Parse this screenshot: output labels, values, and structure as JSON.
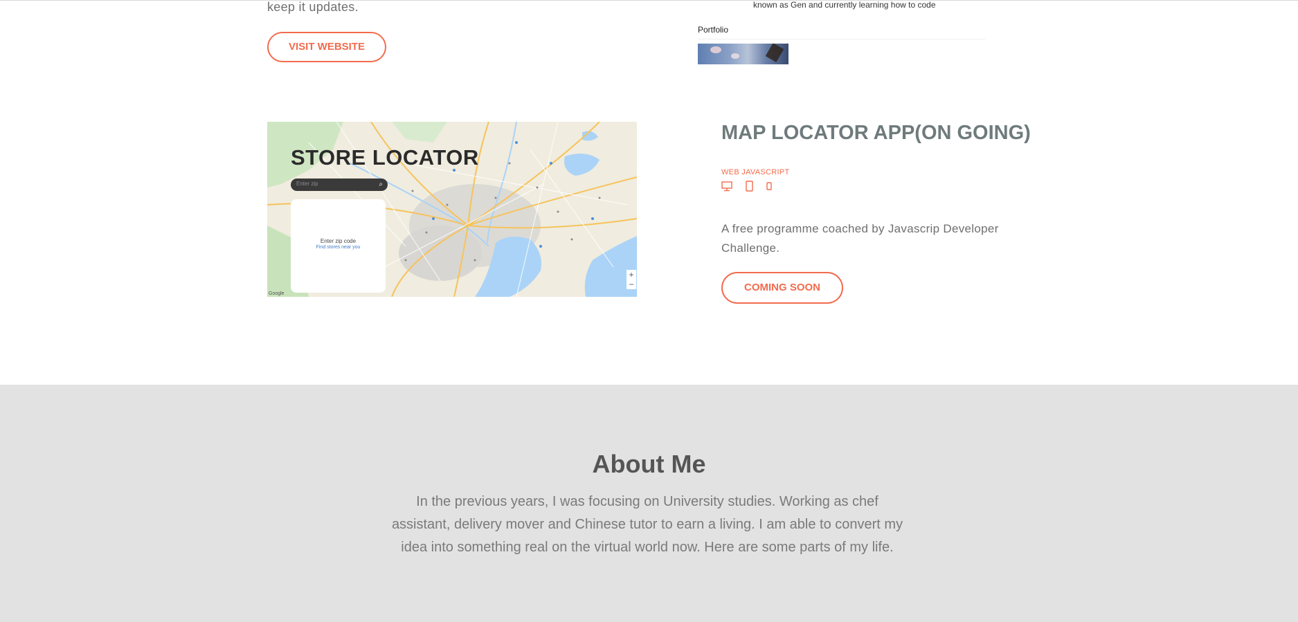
{
  "top_project": {
    "desc_tail": "keep it updates.",
    "button": "VISIT WEBSITE",
    "preview_caption": "known as Gen and currently learning how to code",
    "preview_portfolio": "Portfolio"
  },
  "map_project": {
    "screenshot": {
      "heading": "STORE LOCATOR",
      "search_placeholder": "Enter zip",
      "panel_line1": "Enter zip code",
      "panel_line2": "Find stores near you",
      "zoom_in": "+",
      "zoom_out": "−",
      "google": "Google"
    },
    "title": "MAP LOCATOR APP(ON GOING)",
    "tags": "WEB JAVASCRIPT",
    "device_icons": [
      "desktop-icon",
      "tablet-icon",
      "phone-icon"
    ],
    "description": "A free programme coached by Javascrip Developer Challenge.",
    "button": "COMING SOON"
  },
  "about": {
    "title": "About Me",
    "text": "In the previous years, I was focusing on University studies. Working as chef assistant, delivery mover and Chinese tutor to earn a living. I am able to convert my idea into something real on the virtual world now. Here are some parts of my life."
  },
  "colors": {
    "accent": "#f26b4d",
    "title_gray": "#6f7a7c",
    "about_bg": "#e2e2e2"
  }
}
